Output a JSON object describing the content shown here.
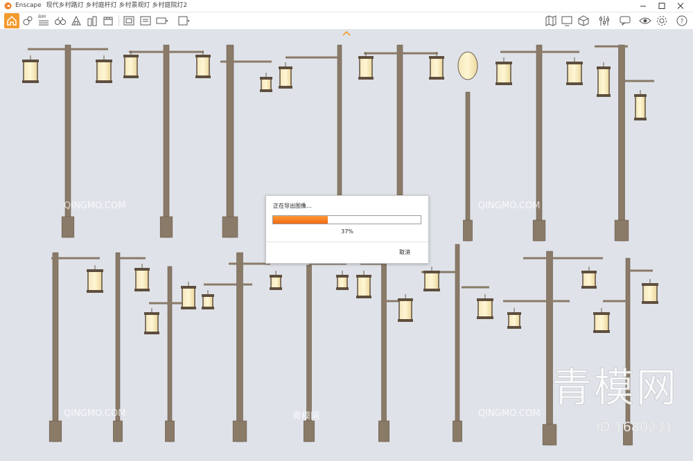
{
  "window": {
    "app_name": "Enscape",
    "tabs": [
      "现代乡村路灯",
      "乡村庭杆灯",
      "乡村景观灯",
      "乡村庭院灯2"
    ],
    "accent": "#f39a2e"
  },
  "toolbar": {
    "icons": [
      "home-icon",
      "navigation-icon",
      "bim-icon",
      "binoculars-icon",
      "house-icon",
      "buildings-icon",
      "book-icon",
      "clapperboard-icon",
      "capture-icon",
      "batch-render-icon",
      "panorama-icon",
      "export-icon",
      "map-icon",
      "display-icon",
      "cube-icon",
      "sliders-icon",
      "chat-icon",
      "eye-icon",
      "gear-icon",
      "help-icon"
    ],
    "bim_label": "BIM"
  },
  "dialog": {
    "title": "正在导出图像…",
    "progress": 0.37,
    "percent_text": "37%",
    "cancel_label": "取消"
  },
  "watermark": {
    "brand_text": "青模网",
    "id_text": "ID:1680231",
    "small_texts": [
      "QINGMO.COM",
      "青模网"
    ]
  }
}
